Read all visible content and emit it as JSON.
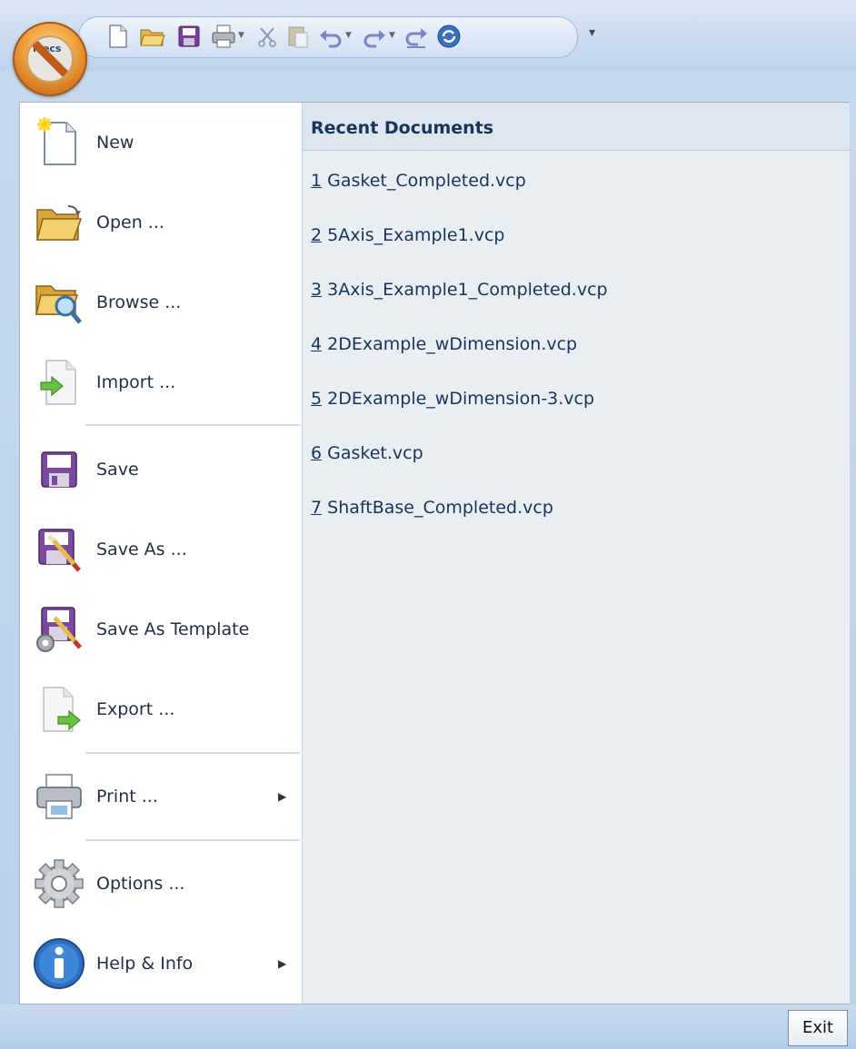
{
  "app": {
    "logo_text": "Mecs"
  },
  "toolbar": {
    "icons": [
      "new-file-icon",
      "open-folder-icon",
      "save-icon",
      "print-icon",
      "cut-icon",
      "paste-icon",
      "undo-icon",
      "redo-icon",
      "redo-repeat-icon",
      "regenerate-icon"
    ],
    "more_glyph": "▾"
  },
  "menu": {
    "items": [
      {
        "label": "New",
        "icon": "new-document-icon"
      },
      {
        "label": "Open ...",
        "icon": "open-folder-icon"
      },
      {
        "label": "Browse ...",
        "icon": "browse-folder-icon"
      },
      {
        "label": "Import ...",
        "icon": "import-icon"
      },
      {
        "label": "Save",
        "icon": "save-icon"
      },
      {
        "label": "Save As ...",
        "icon": "save-as-icon"
      },
      {
        "label": "Save As Template",
        "icon": "save-as-template-icon"
      },
      {
        "label": "Export ...",
        "icon": "export-icon"
      },
      {
        "label": "Print ...",
        "icon": "printer-icon",
        "submenu": true
      },
      {
        "label": "Options ...",
        "icon": "gear-icon"
      },
      {
        "label": "Help & Info",
        "icon": "info-icon",
        "submenu": true
      }
    ]
  },
  "recent": {
    "title": "Recent Documents",
    "items": [
      {
        "num": "1",
        "name": "Gasket_Completed.vcp"
      },
      {
        "num": "2",
        "name": "5Axis_Example1.vcp"
      },
      {
        "num": "3",
        "name": "3Axis_Example1_Completed.vcp"
      },
      {
        "num": "4",
        "name": "2DExample_wDimension.vcp"
      },
      {
        "num": "5",
        "name": "2DExample_wDimension-3.vcp"
      },
      {
        "num": "6",
        "name": "Gasket.vcp"
      },
      {
        "num": "7",
        "name": "ShaftBase_Completed.vcp"
      }
    ]
  },
  "footer": {
    "exit_label": "Exit"
  },
  "colors": {
    "orb": "#f0a03a",
    "accent_text": "#15355e",
    "pane_bg": "#e9eef3"
  }
}
